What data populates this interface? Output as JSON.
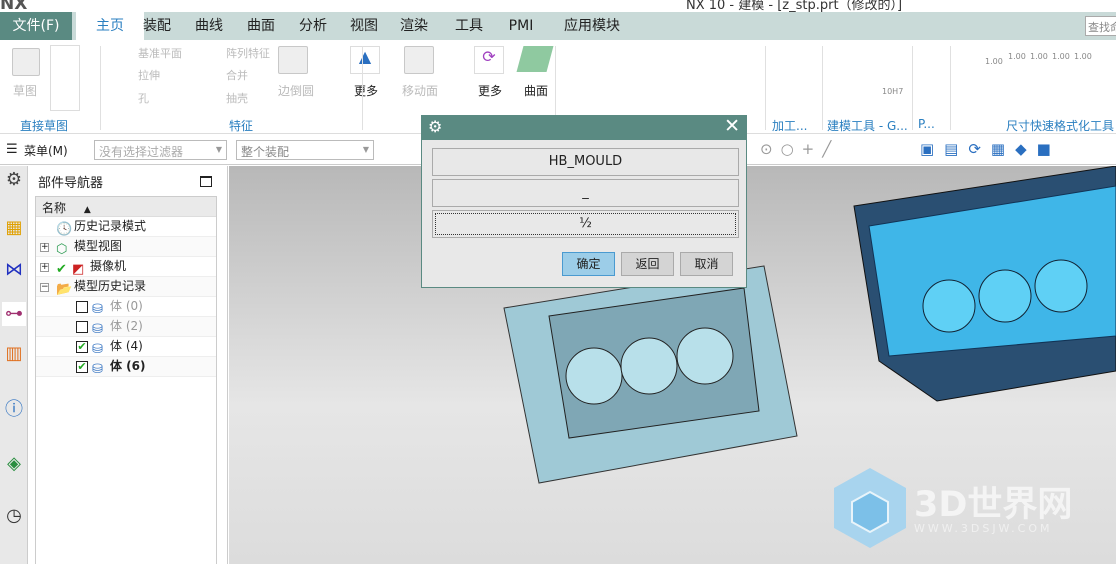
{
  "window": {
    "logo": "NX",
    "title": "NX 10 - 建模 - [z_stp.prt（修改的）]"
  },
  "tabs": [
    {
      "label": "文件(F)"
    },
    {
      "label": "主页"
    },
    {
      "label": "装配"
    },
    {
      "label": "曲线"
    },
    {
      "label": "曲面"
    },
    {
      "label": "分析"
    },
    {
      "label": "视图"
    },
    {
      "label": "渲染"
    },
    {
      "label": "工具"
    },
    {
      "label": "PMI"
    },
    {
      "label": "应用模块"
    }
  ],
  "search_placeholder": "查找命令",
  "ribbon": {
    "sketch": "草图",
    "datum_plane": "基准平面",
    "extrude": "拉伸",
    "hole": "孔",
    "pattern": "阵列特征",
    "unite": "合并",
    "shell": "抽壳",
    "edge_blend": "边倒圆",
    "more1": "更多",
    "move_face": "移动面",
    "more2": "更多",
    "surface": "曲面",
    "tol": "10H7",
    "dims": [
      "1.00",
      "1.00",
      "1.00",
      "1.00",
      "1.00"
    ],
    "groups": {
      "direct_sketch": "直接草图",
      "feature": "特征",
      "machining": "加工...",
      "modeling_tools": "建模工具 - G...",
      "p": "P...",
      "dim_format": "尺寸快速格式化工具 -"
    }
  },
  "toolbar": {
    "menu": "菜单(M)",
    "filter": "没有选择过滤器",
    "scope": "整个装配"
  },
  "navigator": {
    "title": "部件导航器",
    "column": "名称",
    "items": [
      {
        "label": "历史记录模式"
      },
      {
        "label": "模型视图"
      },
      {
        "label": "摄像机"
      },
      {
        "label": "模型历史记录"
      },
      {
        "label": "体 (0)",
        "checked": false
      },
      {
        "label": "体 (2)",
        "checked": false
      },
      {
        "label": "体 (4)",
        "checked": true
      },
      {
        "label": "体 (6)",
        "checked": true
      }
    ]
  },
  "dialog": {
    "line1": "HB_MOULD",
    "line2": "_",
    "line3": "½",
    "ok": "确定",
    "back": "返回",
    "cancel": "取消"
  },
  "watermark": {
    "name": "3D世界网",
    "url": "WWW.3DSJW.COM"
  },
  "colors": {
    "accent": "#5a8a82",
    "tab_bar": "#c9dad8",
    "link": "#2a7fc0",
    "ok_button": "#9ccde8"
  }
}
